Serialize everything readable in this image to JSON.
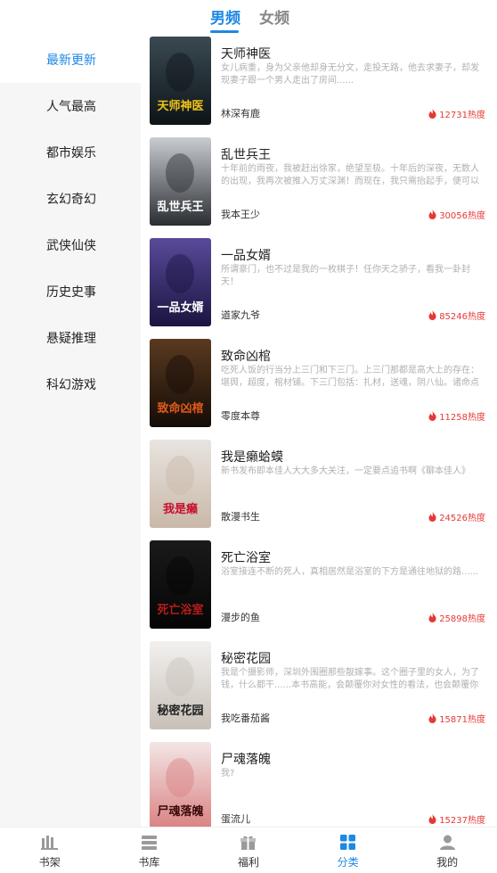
{
  "tabs": {
    "male": "男频",
    "female": "女频"
  },
  "sidebar": {
    "items": [
      {
        "label": "最新更新"
      },
      {
        "label": "人气最高"
      },
      {
        "label": "都市娱乐"
      },
      {
        "label": "玄幻奇幻"
      },
      {
        "label": "武侠仙侠"
      },
      {
        "label": "历史史事"
      },
      {
        "label": "悬疑推理"
      },
      {
        "label": "科幻游戏"
      }
    ]
  },
  "books": [
    {
      "title": "天师神医",
      "desc": "女儿病重，身为父亲他却身无分文，走投无路，他去求妻子，却发现妻子跟一个男人走出了房间......",
      "author": "林深有鹿",
      "heat": "12731热度",
      "cover_text": "天师神医",
      "cover_colors": [
        "#3a4a52",
        "#0e1418",
        "#f0c419"
      ]
    },
    {
      "title": "乱世兵王",
      "desc": "十年前的雨夜，我被赶出徐家，绝望至极。十年后的深夜，无数人的出现，我再次被推入万丈深渊！而现在，我只需抬起手，便可以绝地整...",
      "author": "我本王少",
      "heat": "30056热度",
      "cover_text": "乱世兵王",
      "cover_colors": [
        "#c9ccd0",
        "#2a2e33",
        "#ffffff"
      ]
    },
    {
      "title": "一品女婿",
      "desc": "所谓豪门，也不过是我的一枚棋子！任你天之骄子，看我一卦封天！",
      "author": "道家九爷",
      "heat": "85246热度",
      "cover_text": "一品女婿",
      "cover_colors": [
        "#5a4a9a",
        "#1a1540",
        "#ffffff"
      ]
    },
    {
      "title": "致命凶棺",
      "desc": "吃死人饭的行当分上三门和下三门。上三门那都是高大上的存在：堪舆，超度，棺材铺。下三门包括：扎材，送魂，阴八仙。诸命点说致...",
      "author": "零度本尊",
      "heat": "11258热度",
      "cover_text": "致命凶棺",
      "cover_colors": [
        "#5a3a20",
        "#140c06",
        "#e05a1a"
      ]
    },
    {
      "title": "我是癞蛤蟆",
      "desc": "新书发布即本佳人大大多大关注，一定要点追书啊《聊本佳人》",
      "author": "散漫书生",
      "heat": "24526热度",
      "cover_text": "我是癞",
      "cover_colors": [
        "#e8e4e0",
        "#c9b8a8",
        "#c8102e"
      ]
    },
    {
      "title": "死亡浴室",
      "desc": "浴室接连不断的死人，真相居然是浴室的下方是通往地狱的路......",
      "author": "漫步的鱼",
      "heat": "25898热度",
      "cover_text": "死亡浴室",
      "cover_colors": [
        "#1a1a1a",
        "#050505",
        "#b71c1c"
      ]
    },
    {
      "title": "秘密花园",
      "desc": "我是个摄影师，深圳外围圈那些靓嫁事。这个圈子里的女人，为了钱，什么都干......本书高能，会颠覆你对女性的看法，也会颠覆你的价值观...",
      "author": "我吃番茄酱",
      "heat": "15871热度",
      "cover_text": "秘密花园",
      "cover_colors": [
        "#f2f0ee",
        "#c8c0b8",
        "#222222"
      ]
    },
    {
      "title": "尸魂落魄",
      "desc": "我?",
      "author": "蛋流儿",
      "heat": "15237热度",
      "cover_text": "尸魂落魄",
      "cover_colors": [
        "#f3e6e6",
        "#d98080",
        "#3a0a0a"
      ]
    }
  ],
  "bottom_nav": [
    {
      "label": "书架",
      "icon": "bookshelf-icon"
    },
    {
      "label": "书库",
      "icon": "library-icon"
    },
    {
      "label": "福利",
      "icon": "gift-icon"
    },
    {
      "label": "分类",
      "icon": "category-icon"
    },
    {
      "label": "我的",
      "icon": "profile-icon"
    }
  ],
  "colors": {
    "accent": "#1e88e5",
    "heat": "#e53935",
    "sidebar_bg": "#f6f6f6"
  }
}
